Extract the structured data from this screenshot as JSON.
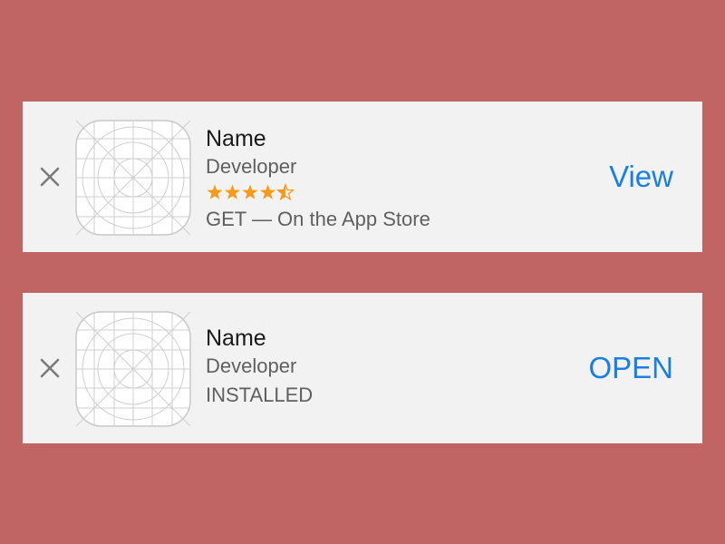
{
  "colors": {
    "background": "#c06563",
    "banner": "#f2f2f2",
    "accent": "#1a7fe0",
    "star": "#f59a1b"
  },
  "banners": [
    {
      "close_icon": "close-x-icon",
      "app_icon": "app-icon-template-grid",
      "name": "Name",
      "developer": "Developer",
      "rating": 4.5,
      "rating_max": 5,
      "subline": "GET — On the App Store",
      "action_label": "View"
    },
    {
      "close_icon": "close-x-icon",
      "app_icon": "app-icon-template-grid",
      "name": "Name",
      "developer": "Developer",
      "subline": "INSTALLED",
      "action_label": "OPEN"
    }
  ]
}
